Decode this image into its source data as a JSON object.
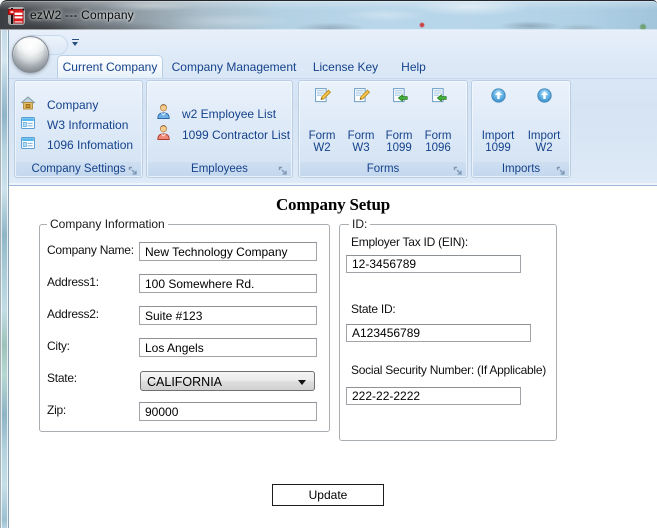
{
  "window": {
    "title": "ezW2 --- Company"
  },
  "tabs": [
    {
      "label": "Current Company",
      "active": true
    },
    {
      "label": "Company Management",
      "active": false
    },
    {
      "label": "License Key",
      "active": false
    },
    {
      "label": "Help",
      "active": false
    }
  ],
  "ribbon": {
    "groups": [
      {
        "title": "Company Settings",
        "items": [
          {
            "label": "Company",
            "icon": "house-icon"
          },
          {
            "label": "W3 Information",
            "icon": "w3-list-icon"
          },
          {
            "label": "1096 Infomation",
            "icon": "form-1096-list-icon"
          }
        ]
      },
      {
        "title": "Employees",
        "items": [
          {
            "label": "w2 Employee List",
            "icon": "employee-person-icon"
          },
          {
            "label": "1099 Contractor List",
            "icon": "contractor-person-icon"
          }
        ]
      },
      {
        "title": "Forms",
        "items": [
          {
            "line1": "Form",
            "line2": "W2",
            "icon": "form-edit-icon"
          },
          {
            "line1": "Form",
            "line2": "W3",
            "icon": "form-edit-icon"
          },
          {
            "line1": "Form",
            "line2": "1099",
            "icon": "form-arrow-icon"
          },
          {
            "line1": "Form",
            "line2": "1096",
            "icon": "form-arrow-icon"
          }
        ]
      },
      {
        "title": "Imports",
        "items": [
          {
            "line1": "Import",
            "line2": "1099",
            "icon": "import-icon"
          },
          {
            "line1": "Import",
            "line2": "W2",
            "icon": "import-icon"
          }
        ]
      }
    ]
  },
  "content": {
    "heading": "Company Setup",
    "company_info": {
      "legend": "Company Information",
      "fields": [
        {
          "label": "Company Name:",
          "value": "New Technology Company"
        },
        {
          "label": "Address1:",
          "value": "100 Somewhere Rd."
        },
        {
          "label": "Address2:",
          "value": "Suite #123"
        },
        {
          "label": "City:",
          "value": "Los Angels"
        },
        {
          "label": "State:",
          "value": "CALIFORNIA"
        },
        {
          "label": "Zip:",
          "value": "90000"
        }
      ]
    },
    "id_section": {
      "legend": "ID:",
      "fields": [
        {
          "label": "Employer Tax ID (EIN):",
          "value": "12-3456789"
        },
        {
          "label": "State ID:",
          "value": "A123456789"
        },
        {
          "label": "Social Security Number: (If Applicable)",
          "value": "222-22-2222"
        }
      ]
    },
    "update_label": "Update"
  },
  "colors": {
    "ribbon_text": "#15428b",
    "ribbon_bg": "#d9e6f4",
    "group_label_bg": "#c6d9ee",
    "title_bar_left": "#4a5055",
    "title_bar_right": "#b4d0e4",
    "accent_red": "#d81e1e",
    "accent_green": "#3fa03f",
    "accent_yellow": "#f0c040",
    "accent_blue": "#2f88c8"
  }
}
